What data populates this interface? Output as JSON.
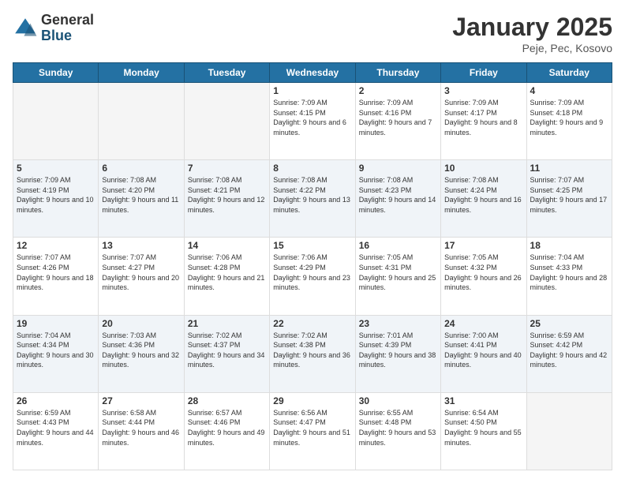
{
  "logo": {
    "general": "General",
    "blue": "Blue"
  },
  "header": {
    "title": "January 2025",
    "subtitle": "Peje, Pec, Kosovo"
  },
  "weekdays": [
    "Sunday",
    "Monday",
    "Tuesday",
    "Wednesday",
    "Thursday",
    "Friday",
    "Saturday"
  ],
  "weeks": [
    [
      {
        "day": "",
        "info": ""
      },
      {
        "day": "",
        "info": ""
      },
      {
        "day": "",
        "info": ""
      },
      {
        "day": "1",
        "info": "Sunrise: 7:09 AM\nSunset: 4:15 PM\nDaylight: 9 hours and 6 minutes."
      },
      {
        "day": "2",
        "info": "Sunrise: 7:09 AM\nSunset: 4:16 PM\nDaylight: 9 hours and 7 minutes."
      },
      {
        "day": "3",
        "info": "Sunrise: 7:09 AM\nSunset: 4:17 PM\nDaylight: 9 hours and 8 minutes."
      },
      {
        "day": "4",
        "info": "Sunrise: 7:09 AM\nSunset: 4:18 PM\nDaylight: 9 hours and 9 minutes."
      }
    ],
    [
      {
        "day": "5",
        "info": "Sunrise: 7:09 AM\nSunset: 4:19 PM\nDaylight: 9 hours and 10 minutes."
      },
      {
        "day": "6",
        "info": "Sunrise: 7:08 AM\nSunset: 4:20 PM\nDaylight: 9 hours and 11 minutes."
      },
      {
        "day": "7",
        "info": "Sunrise: 7:08 AM\nSunset: 4:21 PM\nDaylight: 9 hours and 12 minutes."
      },
      {
        "day": "8",
        "info": "Sunrise: 7:08 AM\nSunset: 4:22 PM\nDaylight: 9 hours and 13 minutes."
      },
      {
        "day": "9",
        "info": "Sunrise: 7:08 AM\nSunset: 4:23 PM\nDaylight: 9 hours and 14 minutes."
      },
      {
        "day": "10",
        "info": "Sunrise: 7:08 AM\nSunset: 4:24 PM\nDaylight: 9 hours and 16 minutes."
      },
      {
        "day": "11",
        "info": "Sunrise: 7:07 AM\nSunset: 4:25 PM\nDaylight: 9 hours and 17 minutes."
      }
    ],
    [
      {
        "day": "12",
        "info": "Sunrise: 7:07 AM\nSunset: 4:26 PM\nDaylight: 9 hours and 18 minutes."
      },
      {
        "day": "13",
        "info": "Sunrise: 7:07 AM\nSunset: 4:27 PM\nDaylight: 9 hours and 20 minutes."
      },
      {
        "day": "14",
        "info": "Sunrise: 7:06 AM\nSunset: 4:28 PM\nDaylight: 9 hours and 21 minutes."
      },
      {
        "day": "15",
        "info": "Sunrise: 7:06 AM\nSunset: 4:29 PM\nDaylight: 9 hours and 23 minutes."
      },
      {
        "day": "16",
        "info": "Sunrise: 7:05 AM\nSunset: 4:31 PM\nDaylight: 9 hours and 25 minutes."
      },
      {
        "day": "17",
        "info": "Sunrise: 7:05 AM\nSunset: 4:32 PM\nDaylight: 9 hours and 26 minutes."
      },
      {
        "day": "18",
        "info": "Sunrise: 7:04 AM\nSunset: 4:33 PM\nDaylight: 9 hours and 28 minutes."
      }
    ],
    [
      {
        "day": "19",
        "info": "Sunrise: 7:04 AM\nSunset: 4:34 PM\nDaylight: 9 hours and 30 minutes."
      },
      {
        "day": "20",
        "info": "Sunrise: 7:03 AM\nSunset: 4:36 PM\nDaylight: 9 hours and 32 minutes."
      },
      {
        "day": "21",
        "info": "Sunrise: 7:02 AM\nSunset: 4:37 PM\nDaylight: 9 hours and 34 minutes."
      },
      {
        "day": "22",
        "info": "Sunrise: 7:02 AM\nSunset: 4:38 PM\nDaylight: 9 hours and 36 minutes."
      },
      {
        "day": "23",
        "info": "Sunrise: 7:01 AM\nSunset: 4:39 PM\nDaylight: 9 hours and 38 minutes."
      },
      {
        "day": "24",
        "info": "Sunrise: 7:00 AM\nSunset: 4:41 PM\nDaylight: 9 hours and 40 minutes."
      },
      {
        "day": "25",
        "info": "Sunrise: 6:59 AM\nSunset: 4:42 PM\nDaylight: 9 hours and 42 minutes."
      }
    ],
    [
      {
        "day": "26",
        "info": "Sunrise: 6:59 AM\nSunset: 4:43 PM\nDaylight: 9 hours and 44 minutes."
      },
      {
        "day": "27",
        "info": "Sunrise: 6:58 AM\nSunset: 4:44 PM\nDaylight: 9 hours and 46 minutes."
      },
      {
        "day": "28",
        "info": "Sunrise: 6:57 AM\nSunset: 4:46 PM\nDaylight: 9 hours and 49 minutes."
      },
      {
        "day": "29",
        "info": "Sunrise: 6:56 AM\nSunset: 4:47 PM\nDaylight: 9 hours and 51 minutes."
      },
      {
        "day": "30",
        "info": "Sunrise: 6:55 AM\nSunset: 4:48 PM\nDaylight: 9 hours and 53 minutes."
      },
      {
        "day": "31",
        "info": "Sunrise: 6:54 AM\nSunset: 4:50 PM\nDaylight: 9 hours and 55 minutes."
      },
      {
        "day": "",
        "info": ""
      }
    ]
  ]
}
